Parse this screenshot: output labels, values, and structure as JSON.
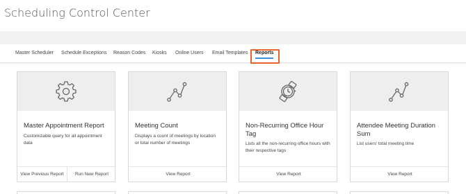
{
  "header": {
    "title": "Scheduling Control Center"
  },
  "tabs": [
    {
      "label": "Master Scheduler"
    },
    {
      "label": "Schedule Exceptions"
    },
    {
      "label": "Reason Codes"
    },
    {
      "label": "Kiosks"
    },
    {
      "label": "Online Users"
    },
    {
      "label": "Email Templates"
    },
    {
      "label": "Reports"
    }
  ],
  "active_tab": "Reports",
  "colors": {
    "accent_underline": "#3a8fd6",
    "highlight_box": "#e8632b"
  },
  "cards": [
    {
      "icon": "gear-icon",
      "title": "Master Appointment Report",
      "description": "Customizable query for all appointment data",
      "links": [
        "View Previous Report",
        "Run New Report"
      ]
    },
    {
      "icon": "line-chart-icon",
      "title": "Meeting Count",
      "description": "Displays a count of meetings by location or total number of meetings",
      "links": [
        "View Report"
      ]
    },
    {
      "icon": "watch-icon",
      "title": "Non-Recurring Office Hour Tag",
      "description": "Lists all the non-recurring office hours with their respective tags",
      "links": [
        "View Report"
      ]
    },
    {
      "icon": "line-chart-icon",
      "title": "Attendee Meeting Duration Sum",
      "description": "List users' total meeting time",
      "links": [
        "View Report"
      ]
    }
  ]
}
